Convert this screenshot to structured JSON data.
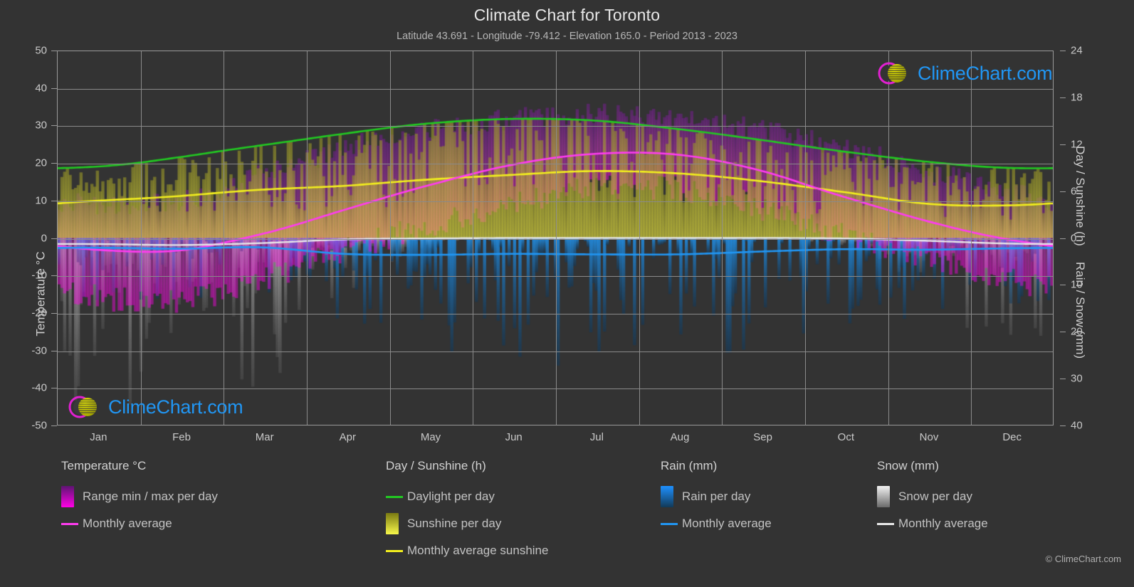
{
  "header": {
    "title": "Climate Chart for Toronto",
    "subtitle": "Latitude 43.691 - Longitude -79.412 - Elevation 165.0 - Period 2013 - 2023"
  },
  "footer": {
    "copyright": "© ClimeChart.com"
  },
  "watermark": {
    "wordmark": "ClimeChart.com"
  },
  "colors": {
    "background": "#333333",
    "grid": "#8a8a8a",
    "axis": "#9a9a9a",
    "text": "#c9c9c9",
    "daylight_green": "#22c922",
    "sunshine_yellow": "#f2ee1e",
    "temp_magenta": "#ff3cf0",
    "rain_blue": "#2196f3",
    "snow_white": "#e8e8e8",
    "logo_blue": "#2196f3",
    "logo_magenta": "#e020d0",
    "logo_yellow": "#d6d600"
  },
  "axes": {
    "left": {
      "label": "Temperature °C",
      "ticks": [
        50,
        40,
        30,
        20,
        10,
        0,
        -10,
        -20,
        -30,
        -40,
        -50
      ],
      "min": -50,
      "max": 50
    },
    "right_top": {
      "label": "Day / Sunshine (h)",
      "ticks": [
        24,
        18,
        12,
        6,
        0
      ],
      "min": 0,
      "max": 24
    },
    "right_bottom": {
      "label": "Rain / Snow (mm)",
      "ticks": [
        0,
        10,
        20,
        30,
        40
      ],
      "min": 0,
      "max": 40
    },
    "x": {
      "ticks": [
        "Jan",
        "Feb",
        "Mar",
        "Apr",
        "May",
        "Jun",
        "Jul",
        "Aug",
        "Sep",
        "Oct",
        "Nov",
        "Dec"
      ]
    }
  },
  "legend": {
    "temperature": {
      "heading": "Temperature °C",
      "items": [
        {
          "label": "Range min / max per day",
          "marker": "gradient-magenta"
        },
        {
          "label": "Monthly average",
          "marker": "line-magenta"
        }
      ]
    },
    "daysunshine": {
      "heading": "Day / Sunshine (h)",
      "items": [
        {
          "label": "Daylight per day",
          "marker": "line-green"
        },
        {
          "label": "Sunshine per day",
          "marker": "gradient-yellow"
        },
        {
          "label": "Monthly average sunshine",
          "marker": "line-yellow"
        }
      ]
    },
    "rain": {
      "heading": "Rain (mm)",
      "items": [
        {
          "label": "Rain per day",
          "marker": "gradient-blue"
        },
        {
          "label": "Monthly average",
          "marker": "line-blue"
        }
      ]
    },
    "snow": {
      "heading": "Snow (mm)",
      "items": [
        {
          "label": "Snow per day",
          "marker": "gradient-white"
        },
        {
          "label": "Monthly average",
          "marker": "line-white"
        }
      ]
    }
  },
  "chart_data": {
    "type": "line",
    "title": "Climate Chart for Toronto",
    "subtitle": "Latitude 43.691 - Longitude -79.412 - Elevation 165.0 - Period 2013 - 2023",
    "xlabel": "",
    "ylabel": "Temperature °C",
    "ylabel_right_top": "Day / Sunshine (h)",
    "ylabel_right_bottom": "Rain / Snow (mm)",
    "ylim": [
      -50,
      50
    ],
    "ylim_right_top": [
      0,
      24
    ],
    "ylim_right_bottom": [
      0,
      40
    ],
    "grid": true,
    "legend_position": "below",
    "categories": [
      "Jan",
      "Feb",
      "Mar",
      "Apr",
      "May",
      "Jun",
      "Jul",
      "Aug",
      "Sep",
      "Oct",
      "Nov",
      "Dec"
    ],
    "series": [
      {
        "name": "Daylight per day",
        "unit": "h",
        "axis": "right_top",
        "color": "#22c922",
        "values": [
          9.2,
          10.4,
          11.9,
          13.4,
          14.7,
          15.3,
          15.1,
          14.0,
          12.6,
          11.1,
          9.8,
          9.0
        ]
      },
      {
        "name": "Monthly average sunshine",
        "unit": "h",
        "axis": "right_top",
        "color": "#f2ee1e",
        "values": [
          4.8,
          5.4,
          6.2,
          6.7,
          7.5,
          8.1,
          8.6,
          8.3,
          7.3,
          5.9,
          4.4,
          4.2
        ]
      },
      {
        "name": "Monthly average temperature",
        "unit": "°C",
        "axis": "left",
        "color": "#ff3cf0",
        "values": [
          -3.2,
          -3.3,
          1.0,
          7.5,
          14.0,
          19.5,
          22.5,
          22.3,
          18.0,
          11.0,
          4.5,
          -0.5
        ]
      },
      {
        "name": "Monthly average rain",
        "unit": "mm",
        "axis": "right_bottom",
        "color": "#2196f3",
        "values": [
          2.1,
          2.3,
          2.0,
          3.4,
          3.6,
          3.4,
          3.5,
          3.5,
          2.9,
          2.4,
          2.5,
          2.2
        ]
      },
      {
        "name": "Monthly average snow",
        "unit": "mm",
        "axis": "right_bottom",
        "color": "#e8e8e8",
        "values": [
          1.3,
          1.5,
          1.1,
          0.3,
          0.1,
          0.0,
          0.0,
          0.0,
          0.0,
          0.1,
          0.6,
          1.2
        ]
      }
    ],
    "daily_ranges": {
      "temperature_min_max": {
        "name": "Range min / max per day",
        "color_gradient": [
          "#7b1fa2",
          "#ff3cf0"
        ],
        "monthly_min": [
          -16,
          -17,
          -11,
          -3,
          3,
          9,
          13,
          13,
          8,
          1,
          -5,
          -11
        ],
        "monthly_max": [
          9,
          10,
          17,
          24,
          29,
          32,
          33,
          32,
          29,
          24,
          18,
          12
        ]
      },
      "sunshine_per_day": {
        "name": "Sunshine per day",
        "color_gradient": [
          "#8a8a20",
          "#f2ee1e"
        ],
        "monthly_max": [
          9.2,
          10.4,
          11.9,
          13.4,
          14.7,
          15.3,
          15.1,
          14.0,
          12.6,
          11.1,
          9.8,
          9.0
        ]
      },
      "rain_per_day": {
        "name": "Rain per day",
        "color_gradient": [
          "#2196f3",
          "#103a5c"
        ],
        "monthly_max": [
          14,
          15,
          13,
          22,
          24,
          26,
          28,
          27,
          24,
          20,
          18,
          15
        ]
      },
      "snow_per_day": {
        "name": "Snow per day",
        "color_gradient": [
          "#f0f0f0",
          "#6a6a6a"
        ],
        "monthly_max": [
          36,
          38,
          30,
          12,
          2,
          0,
          0,
          0,
          0,
          3,
          18,
          34
        ]
      }
    }
  }
}
